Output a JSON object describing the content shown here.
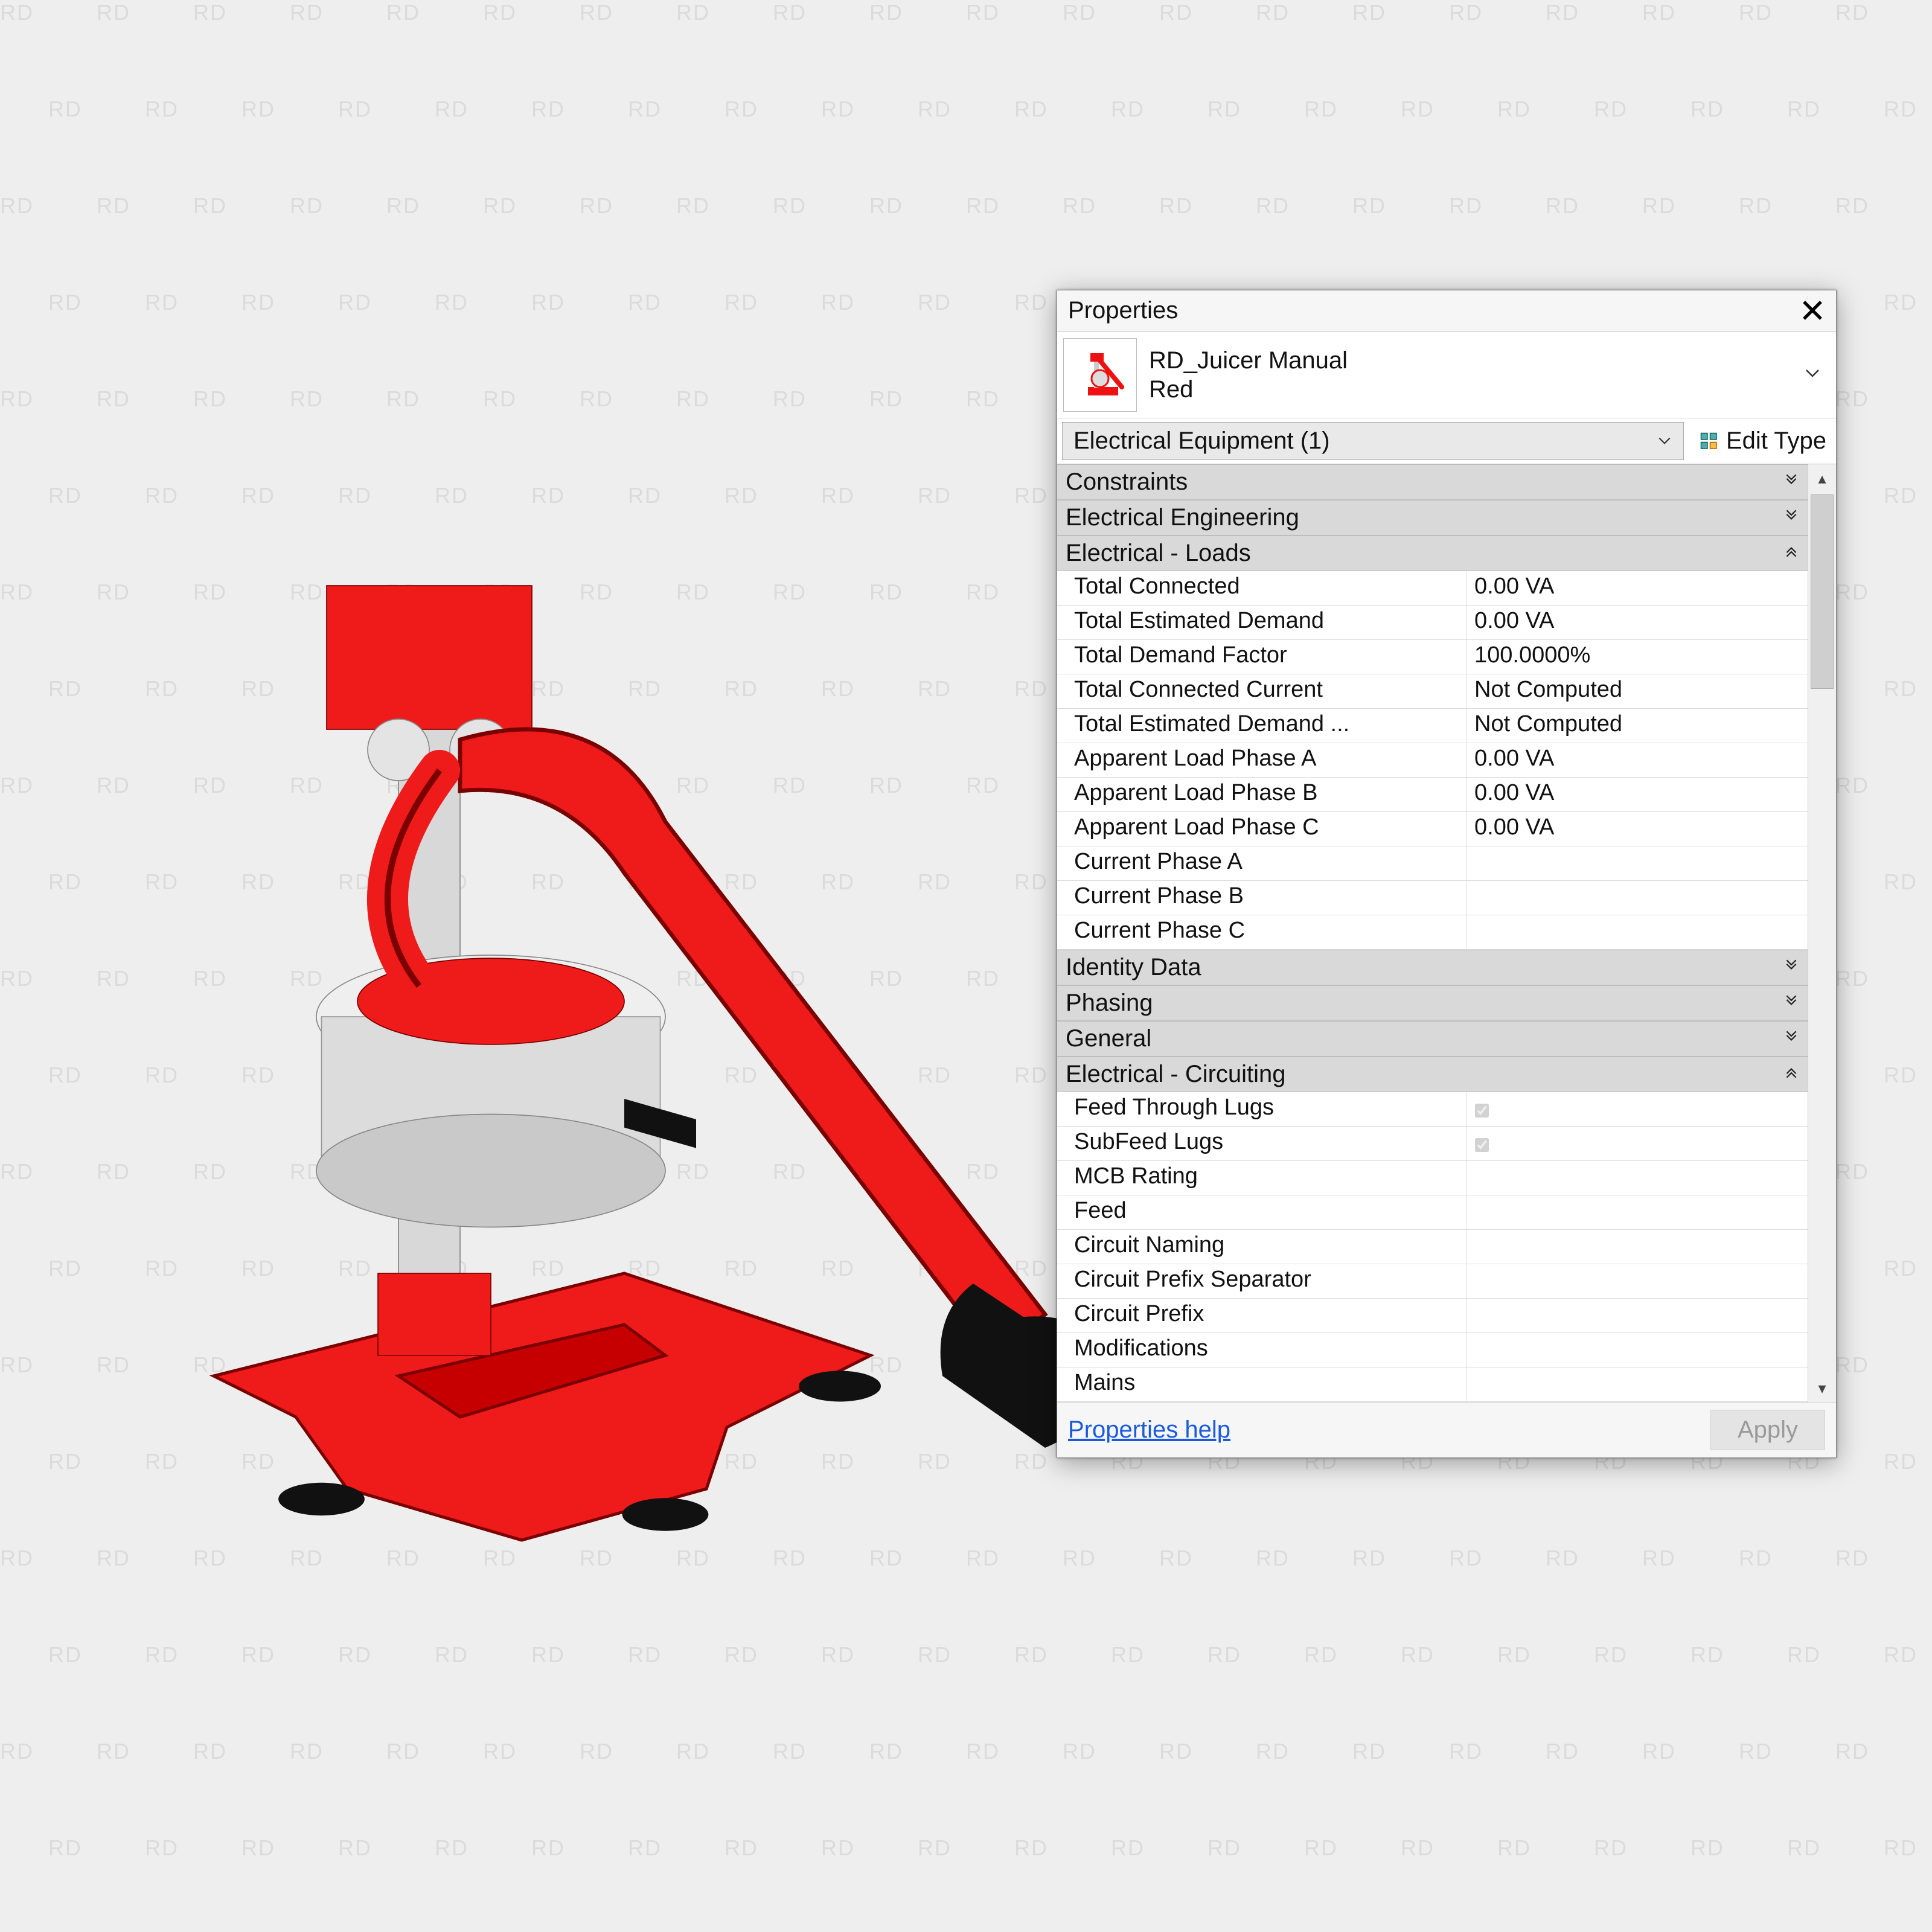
{
  "panel": {
    "title": "Properties",
    "family_name": "RD_Juicer Manual",
    "type_name": "Red",
    "selector": "Electrical Equipment (1)",
    "edit_type": "Edit Type",
    "help": "Properties help",
    "apply": "Apply"
  },
  "categories": [
    {
      "name": "Constraints",
      "state": "collapsed",
      "rows": []
    },
    {
      "name": "Electrical Engineering",
      "state": "collapsed",
      "rows": []
    },
    {
      "name": "Electrical - Loads",
      "state": "expanded",
      "rows": [
        {
          "k": "Total Connected",
          "v": "0.00 VA"
        },
        {
          "k": "Total Estimated Demand",
          "v": "0.00 VA"
        },
        {
          "k": "Total Demand Factor",
          "v": "100.0000%"
        },
        {
          "k": "Total Connected Current",
          "v": "Not Computed"
        },
        {
          "k": "Total Estimated Demand ...",
          "v": "Not Computed"
        },
        {
          "k": "Apparent Load Phase A",
          "v": "0.00 VA"
        },
        {
          "k": "Apparent Load Phase B",
          "v": "0.00 VA"
        },
        {
          "k": "Apparent Load Phase C",
          "v": "0.00 VA"
        },
        {
          "k": "Current Phase A",
          "v": ""
        },
        {
          "k": "Current Phase B",
          "v": ""
        },
        {
          "k": "Current Phase C",
          "v": ""
        }
      ]
    },
    {
      "name": "Identity Data",
      "state": "collapsed",
      "rows": []
    },
    {
      "name": "Phasing",
      "state": "collapsed",
      "rows": []
    },
    {
      "name": "General",
      "state": "collapsed",
      "rows": []
    },
    {
      "name": "Electrical - Circuiting",
      "state": "expanded",
      "rows": [
        {
          "k": "Feed Through Lugs",
          "v": "",
          "check": true
        },
        {
          "k": "SubFeed Lugs",
          "v": "",
          "check": true
        },
        {
          "k": "MCB Rating",
          "v": ""
        },
        {
          "k": "Feed",
          "v": ""
        },
        {
          "k": "Circuit Naming",
          "v": ""
        },
        {
          "k": "Circuit Prefix Separator",
          "v": ""
        },
        {
          "k": "Circuit Prefix",
          "v": ""
        },
        {
          "k": "Modifications",
          "v": ""
        },
        {
          "k": "Mains",
          "v": ""
        }
      ]
    }
  ]
}
